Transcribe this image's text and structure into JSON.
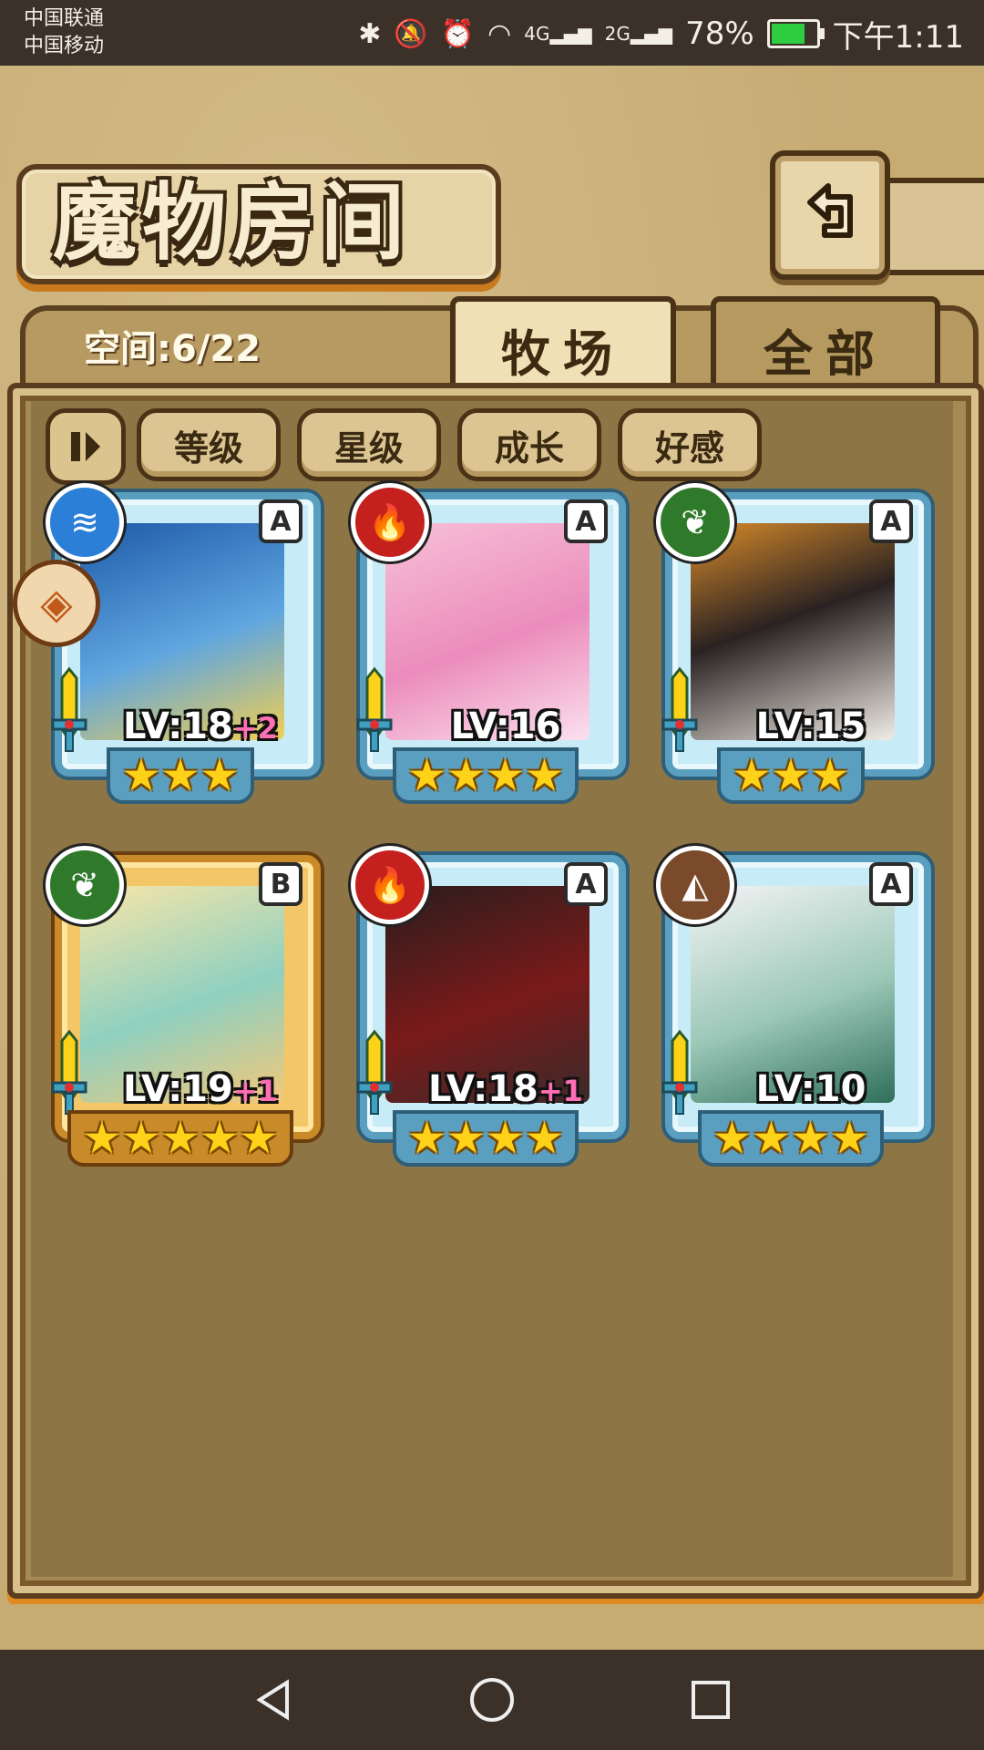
{
  "status_bar": {
    "carrier_1": "中国联通",
    "carrier_2": "中国移动",
    "network_1": "4G",
    "network_2": "2G",
    "battery": "78%",
    "time": "下午1:11"
  },
  "header": {
    "title": "魔物房间",
    "back_icon": "back-arrow-icon"
  },
  "storage": {
    "label": "空间:6/22"
  },
  "tabs": [
    {
      "label": "牧场",
      "active": true
    },
    {
      "label": "全部",
      "active": false
    }
  ],
  "sort": {
    "toggle_icon": "pause-sort-icon",
    "buttons": [
      "等级",
      "星级",
      "成长",
      "好感"
    ]
  },
  "monsters": [
    {
      "element": "water",
      "rank": "A",
      "level": "LV:18",
      "bonus": "+2",
      "stars": 3,
      "frame": "blue",
      "favorite": true
    },
    {
      "element": "fire",
      "rank": "A",
      "level": "LV:16",
      "bonus": "",
      "stars": 4,
      "frame": "blue",
      "favorite": false
    },
    {
      "element": "wood",
      "rank": "A",
      "level": "LV:15",
      "bonus": "",
      "stars": 3,
      "frame": "blue",
      "favorite": false
    },
    {
      "element": "wood",
      "rank": "B",
      "level": "LV:19",
      "bonus": "+1",
      "stars": 5,
      "frame": "gold",
      "favorite": false
    },
    {
      "element": "fire",
      "rank": "A",
      "level": "LV:18",
      "bonus": "+1",
      "stars": 4,
      "frame": "blue",
      "favorite": false
    },
    {
      "element": "earth",
      "rank": "A",
      "level": "LV:10",
      "bonus": "",
      "stars": 4,
      "frame": "blue",
      "favorite": false
    }
  ],
  "colors": {
    "water": "#2b7fd6",
    "fire": "#c4201e",
    "wood": "#2f7a2a",
    "earth": "#7a4a2a"
  }
}
